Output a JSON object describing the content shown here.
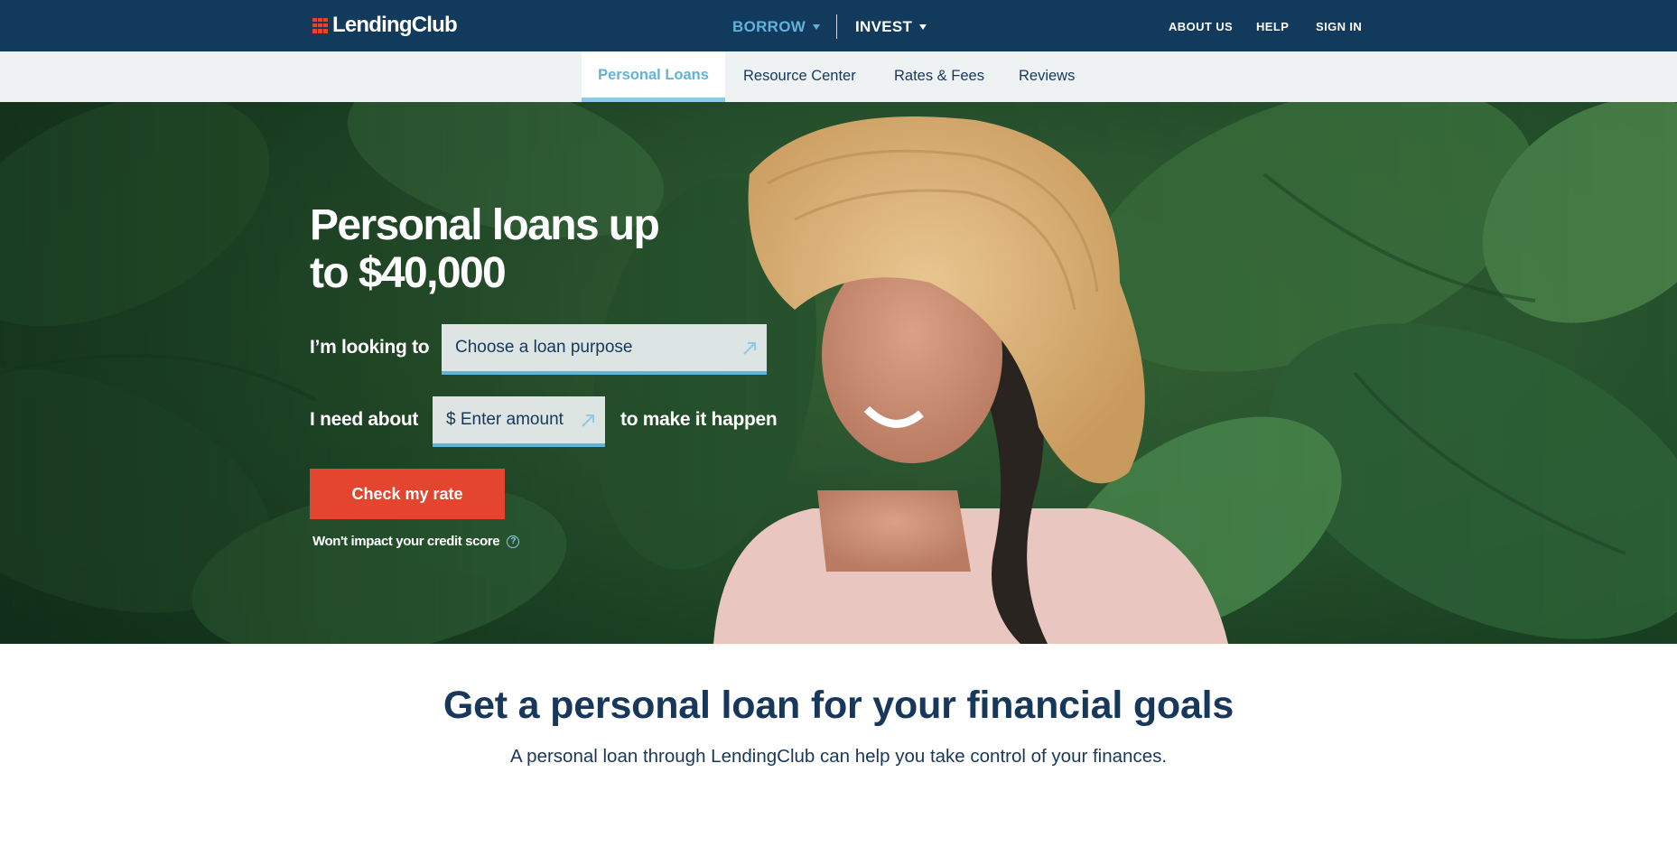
{
  "brand": {
    "name": "LendingClub",
    "accent": "#e4452f",
    "nav_bg": "#123a5c",
    "highlight": "#63b3d9"
  },
  "topnav": {
    "borrow_label": "BORROW",
    "invest_label": "INVEST",
    "about_label": "ABOUT US",
    "help_label": "HELP",
    "signin_label": "SIGN IN"
  },
  "subnav": {
    "tabs": [
      {
        "label": "Personal Loans",
        "active": true
      },
      {
        "label": "Resource Center",
        "active": false
      },
      {
        "label": "Rates & Fees",
        "active": false
      },
      {
        "label": "Reviews",
        "active": false
      }
    ]
  },
  "hero": {
    "title_line1": "Personal loans up",
    "title_line2": "to $40,000",
    "looking_label": "I’m looking to",
    "purpose_placeholder": "Choose a loan purpose",
    "need_label": "I need about",
    "amount_placeholder": "$ Enter amount",
    "happen_label": "to make it happen",
    "cta_label": "Check my rate",
    "disclaimer": "Won't impact your credit score",
    "info_glyph": "?"
  },
  "section": {
    "title": "Get a personal loan for your financial goals",
    "subtitle": "A personal loan through LendingClub can help you take control of your finances."
  }
}
